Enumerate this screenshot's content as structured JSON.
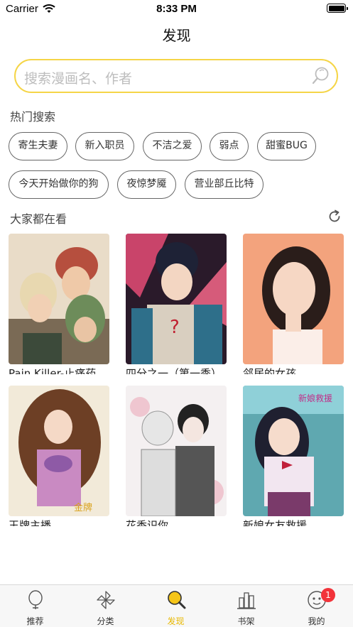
{
  "status_bar": {
    "carrier": "Carrier",
    "time": "8:33 PM"
  },
  "nav": {
    "title": "发现"
  },
  "search": {
    "placeholder": "搜索漫画名、作者"
  },
  "hot_search": {
    "title": "热门搜索",
    "tags": [
      "寄生夫妻",
      "新入职员",
      "不洁之爱",
      "弱点",
      "甜蜜BUG",
      "今天开始做你的狗",
      "夜惊梦魇",
      "营业部丘比特"
    ]
  },
  "everyone_watching": {
    "title": "大家都在看",
    "comics": [
      {
        "title": "Pain Killer-止痛药"
      },
      {
        "title": "四分之一（第一季）"
      },
      {
        "title": "邻居的女孩"
      },
      {
        "title": "王牌主播"
      },
      {
        "title": "花香识你"
      },
      {
        "title": "新娘女友救援"
      }
    ]
  },
  "tabbar": {
    "items": [
      {
        "label": "推荐",
        "icon": "balloon-icon"
      },
      {
        "label": "分类",
        "icon": "pinwheel-icon"
      },
      {
        "label": "发现",
        "icon": "magnifier-icon",
        "active": true
      },
      {
        "label": "书架",
        "icon": "bookshelf-icon"
      },
      {
        "label": "我的",
        "icon": "profile-icon",
        "badge": "1"
      }
    ]
  },
  "colors": {
    "accent": "#f5d547",
    "active_tab": "#e8b800",
    "badge": "#f2333a"
  }
}
